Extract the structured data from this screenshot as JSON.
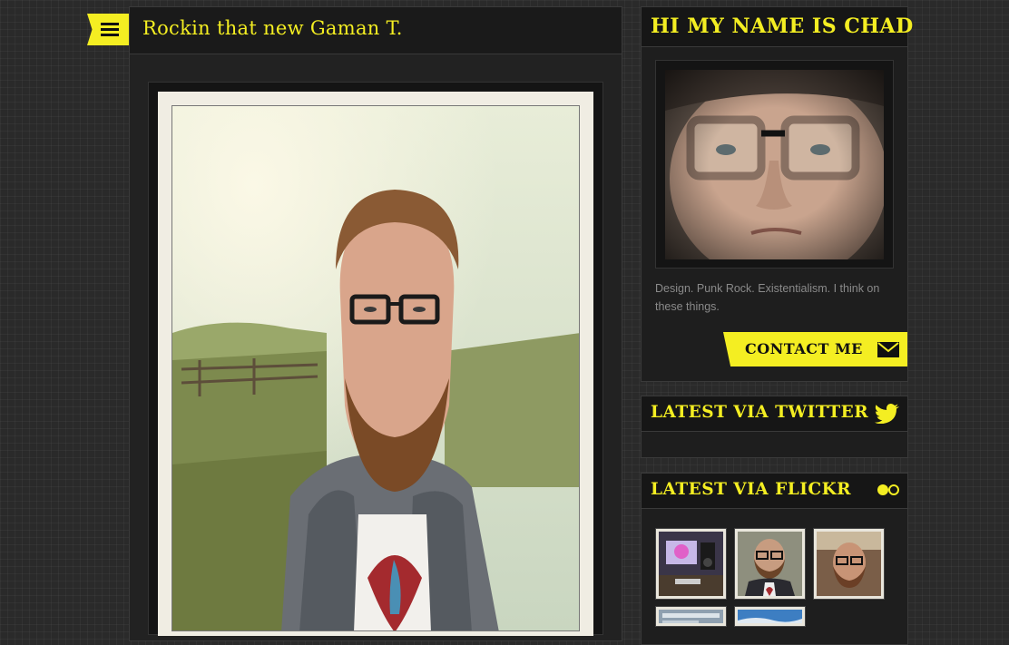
{
  "post": {
    "title": "Rockin that new Gaman T."
  },
  "about": {
    "heading": "HI MY NAME IS CHAD",
    "bio": "Design. Punk Rock. Existentialism. I think on these things.",
    "contact_label": "CONTACT ME"
  },
  "twitter": {
    "heading": "LATEST VIA TWITTER"
  },
  "flickr": {
    "heading": "LATEST VIA FLICKR"
  },
  "icons": {
    "menu": "hamburger-menu-icon",
    "contact": "envelope-icon",
    "twitter": "twitter-bird-icon",
    "flickr": "flickr-dots-icon"
  },
  "colors": {
    "accent": "#f4ee22",
    "background": "#2a2a2a",
    "panel": "#1e1e1e",
    "bio_text": "#8a8a8a"
  }
}
